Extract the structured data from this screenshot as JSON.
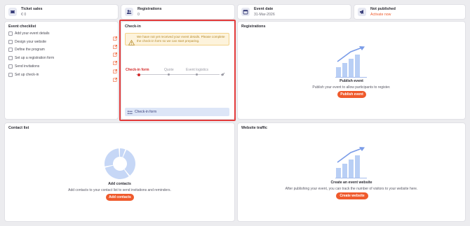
{
  "stats": [
    {
      "label": "Ticket sales",
      "value": "€ 0",
      "icon": "ticket-icon"
    },
    {
      "label": "Registrations",
      "value": "0",
      "icon": "people-icon"
    },
    {
      "label": "Event date",
      "value": "31-Mar-2026",
      "icon": "calendar-icon"
    },
    {
      "label": "Not published",
      "value": "Activate now",
      "icon": "megaphone-icon"
    }
  ],
  "checklist": {
    "title": "Event checklist",
    "items": [
      "Add your event details",
      "Design your website",
      "Define the program",
      "Set up a registration form",
      "Send invitations",
      "Set up check-in"
    ]
  },
  "checkin": {
    "title": "Check-in",
    "alert": "We have not yet received your event details. Please complete the check-in form so we can start preparing.",
    "steps": [
      "Check-in form",
      "Quote",
      "Event logistics"
    ],
    "form_button": "Check-in form"
  },
  "registrations": {
    "title": "Registrations",
    "heading": "Publish event",
    "sub": "Publish your event to allow participants to register.",
    "button": "Publish event"
  },
  "contacts": {
    "title": "Contact list",
    "heading": "Add contacts",
    "sub": "Add contacts to your contact list to send invitations and reminders.",
    "button": "Add contacts"
  },
  "traffic": {
    "title": "Website traffic",
    "heading": "Create an event website",
    "sub": "After publishing your event, you can track the number of visitors to your website here.",
    "button": "Create website"
  },
  "colors": {
    "accent": "#ef5a2c",
    "highlight": "#e33b3b",
    "chart_blue": "#b9cff5"
  }
}
